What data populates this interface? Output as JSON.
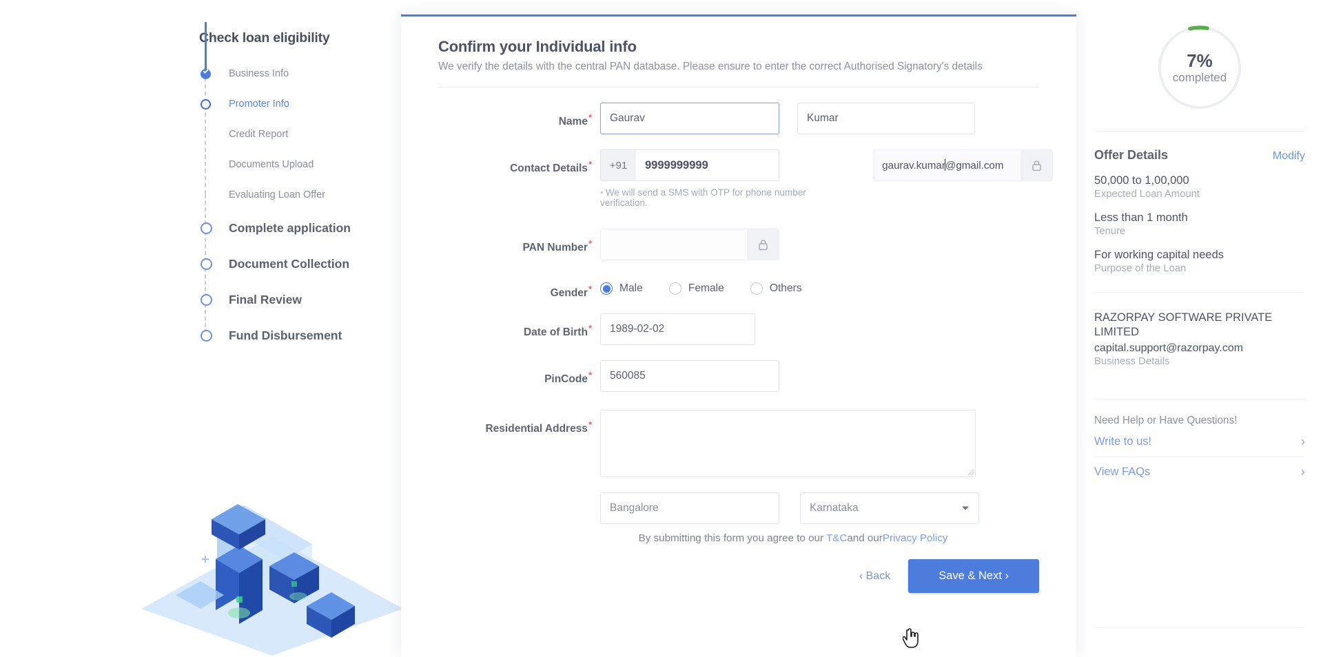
{
  "stepper": {
    "title": "Check loan eligibility",
    "steps": [
      {
        "label": "Business Info",
        "state": "done",
        "kind": "sub"
      },
      {
        "label": "Promoter Info",
        "state": "current",
        "kind": "sub"
      },
      {
        "label": "Credit Report",
        "state": "todo",
        "kind": "sub"
      },
      {
        "label": "Documents Upload",
        "state": "todo",
        "kind": "sub"
      },
      {
        "label": "Evaluating Loan Offer",
        "state": "todo",
        "kind": "sub"
      },
      {
        "label": "Complete application",
        "state": "todo",
        "kind": "major"
      },
      {
        "label": "Document Collection",
        "state": "todo",
        "kind": "major"
      },
      {
        "label": "Final Review",
        "state": "todo",
        "kind": "major"
      },
      {
        "label": "Fund Disbursement",
        "state": "todo",
        "kind": "major"
      }
    ]
  },
  "form": {
    "title": "Confirm your Individual info",
    "subtitle": "We verify the details with the central PAN database. Please ensure to enter the correct Authorised Signatory's details",
    "name": {
      "label": "Name",
      "first_value": "Gaurav",
      "last_value": "Kumar"
    },
    "contact": {
      "label": "Contact Details",
      "country_code": "+91",
      "phone_value": "9999999999",
      "email_value": "gaurav.kumar@gmail.com",
      "email_locked_icon": "lock-icon",
      "hint": "We will send a SMS with OTP for phone number verification."
    },
    "pan": {
      "label": "PAN Number",
      "value": "",
      "locked_icon": "lock-icon"
    },
    "gender": {
      "label": "Gender",
      "options": [
        "Male",
        "Female",
        "Others"
      ],
      "selected": "Male"
    },
    "dob": {
      "label": "Date of Birth",
      "value": "1989-02-02"
    },
    "pincode": {
      "label": "PinCode",
      "value": "560085"
    },
    "address": {
      "label": "Residential Address",
      "value": ""
    },
    "city": {
      "value": "Bangalore"
    },
    "state": {
      "value": "Karnataka",
      "chevron": "chevron-down-icon"
    },
    "terms": {
      "prefix": "By submitting this form you agree to our ",
      "tnc": "T&C",
      "middle": "and our",
      "privacy": "Privacy Policy"
    },
    "buttons": {
      "back": "‹ Back",
      "next": "Save & Next ›"
    }
  },
  "right": {
    "progress": {
      "percent": "7%",
      "caption": "completed",
      "value": 7,
      "arc_color": "#5cab4c"
    },
    "offer": {
      "title": "Offer Details",
      "modify": "Modify",
      "fields": [
        {
          "value": "50,000 to 1,00,000",
          "key": "Expected Loan Amount"
        },
        {
          "value": "Less than 1 month",
          "key": "Tenure"
        },
        {
          "value": "For working capital needs",
          "key": "Purpose of the Loan"
        }
      ]
    },
    "business": {
      "name": "RAZORPAY SOFTWARE PRIVATE LIMITED",
      "email": "capital.support@razorpay.com",
      "key": "Business Details"
    },
    "help": {
      "question": "Need Help or Have Questions!",
      "links": [
        {
          "label": "Write to us!",
          "chevron": "chevron-right-icon"
        },
        {
          "label": "View FAQs",
          "chevron": "chevron-right-icon"
        }
      ]
    }
  },
  "colors": {
    "accent": "#4c7ddc",
    "link": "#7ba0e8",
    "required": "#e3656b",
    "progress_green": "#5cab4c"
  }
}
